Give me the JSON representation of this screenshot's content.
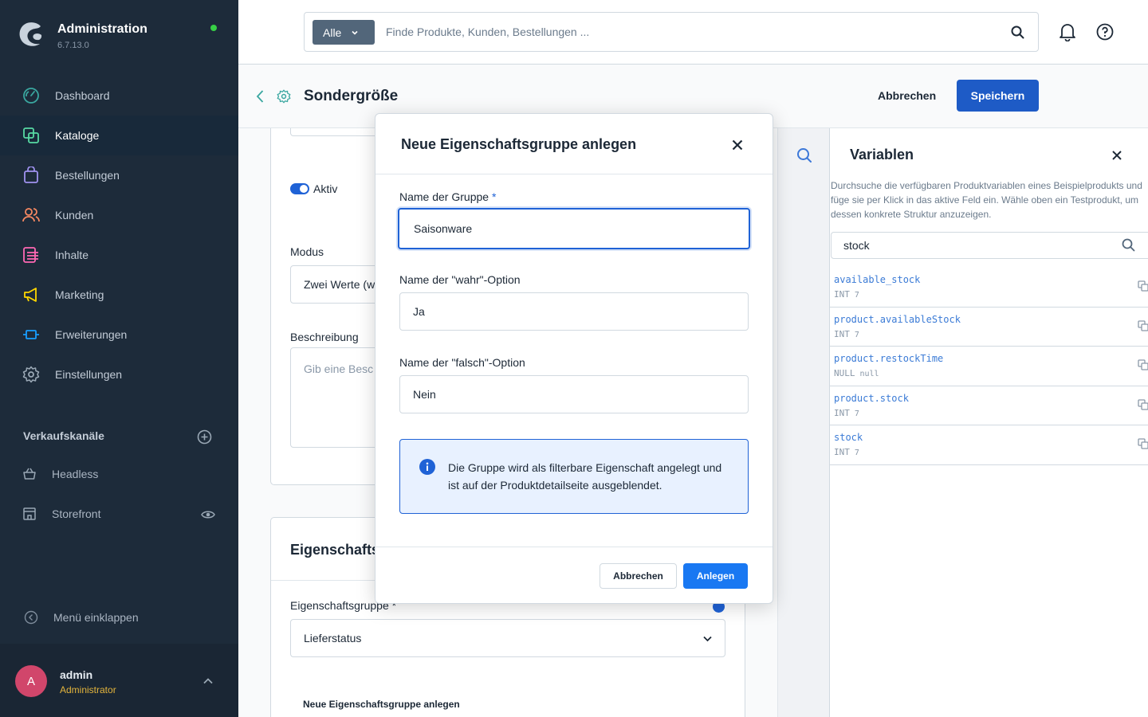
{
  "sidebar": {
    "brand_title": "Administration",
    "brand_version": "6.7.13.0",
    "items": [
      {
        "label": "Dashboard",
        "icon": "dashboard-icon",
        "color": "#3aa7a0"
      },
      {
        "label": "Kataloge",
        "icon": "catalog-icon",
        "color": "#57d9a3"
      },
      {
        "label": "Bestellungen",
        "icon": "orders-icon",
        "color": "#a092f0"
      },
      {
        "label": "Kunden",
        "icon": "customers-icon",
        "color": "#f88962"
      },
      {
        "label": "Inhalte",
        "icon": "content-icon",
        "color": "#ff68b4"
      },
      {
        "label": "Marketing",
        "icon": "marketing-icon",
        "color": "#ffd700"
      },
      {
        "label": "Erweiterungen",
        "icon": "extensions-icon",
        "color": "#189eff"
      },
      {
        "label": "Einstellungen",
        "icon": "settings-icon",
        "color": "#9aa8b5"
      }
    ],
    "active_index": 1,
    "sales_channels_title": "Verkaufskanäle",
    "channels": [
      {
        "label": "Headless",
        "icon": "basket-icon"
      },
      {
        "label": "Storefront",
        "icon": "storefront-icon"
      }
    ],
    "collapse_label": "Menü einklappen",
    "user": {
      "initial": "A",
      "name": "admin",
      "role": "Administrator"
    }
  },
  "topbar": {
    "search_type": "Alle",
    "search_placeholder": "Finde Produkte, Kunden, Bestellungen ..."
  },
  "smartbar": {
    "title": "Sondergröße",
    "cancel_label": "Abbrechen",
    "save_label": "Speichern"
  },
  "content": {
    "active_label": "Aktiv",
    "mode_label": "Modus",
    "mode_value": "Zwei Werte (w",
    "description_label": "Beschreibung",
    "description_placeholder": "Gib eine Besc",
    "card2_title": "Eigenschafts",
    "property_group_label": "Eigenschaftsgruppe *",
    "property_group_value": "Lieferstatus",
    "new_group_link": "Neue Eigenschaftsgruppe anlegen"
  },
  "variables": {
    "title": "Variablen",
    "description": "Durchsuche die verfügbaren Produktvariablen eines Beispielprodukts und füge sie per Klick in das aktive Feld ein. Wähle oben ein Testprodukt, um dessen konkrete Struktur anzuzeigen.",
    "search_value": "stock",
    "items": [
      {
        "name": "available_stock",
        "type": "INT",
        "value": "7"
      },
      {
        "name": "product.availableStock",
        "type": "INT",
        "value": "7"
      },
      {
        "name": "product.restockTime",
        "type": "NULL",
        "value": "null"
      },
      {
        "name": "product.stock",
        "type": "INT",
        "value": "7"
      },
      {
        "name": "stock",
        "type": "INT",
        "value": "7"
      }
    ]
  },
  "modal": {
    "title": "Neue Eigenschaftsgruppe anlegen",
    "group_name_label": "Name der Gruppe",
    "required_mark": "*",
    "group_name_value": "Saisonware",
    "true_label": "Name der \"wahr\"-Option",
    "true_value": "Ja",
    "false_label": "Name der \"falsch\"-Option",
    "false_value": "Nein",
    "info_text": "Die Gruppe wird als filterbare Eigenschaft angelegt und ist auf der Produktdetailseite ausgeblendet.",
    "cancel_label": "Abbrechen",
    "create_label": "Anlegen"
  },
  "colors": {
    "sidebar_bg": "#1d2b3a",
    "primary": "#1f62d6",
    "create_button": "#1978f2"
  }
}
